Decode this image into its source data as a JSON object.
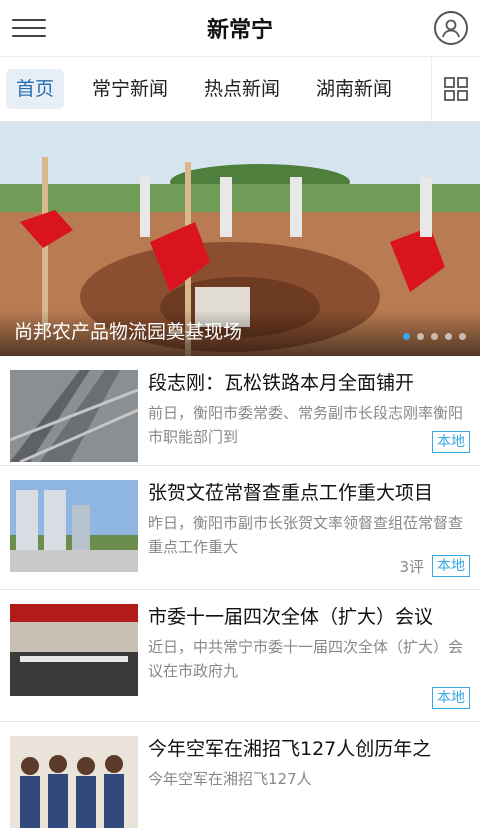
{
  "header": {
    "title": "新常宁"
  },
  "tabs": [
    {
      "label": "首页"
    },
    {
      "label": "常宁新闻"
    },
    {
      "label": "热点新闻"
    },
    {
      "label": "湖南新闻"
    }
  ],
  "banner": {
    "caption": "尚邦农产品物流园奠基现场",
    "slides": 5,
    "active_slide": 1
  },
  "news": [
    {
      "headline": "段志刚：瓦松铁路本月全面铺开",
      "summary": "前日，衡阳市委常委、常务副市长段志刚率衡阳市职能部门到",
      "comments": "",
      "tag": "本地"
    },
    {
      "headline": "张贺文莅常督查重点工作重大项目",
      "summary": "昨日，衡阳市副市长张贺文率领督查组莅常督查重点工作重大",
      "comments": "3评",
      "tag": "本地"
    },
    {
      "headline": "市委十一届四次全体（扩大）会议",
      "summary": "近日，中共常宁市委十一届四次全体（扩大）会议在市政府九",
      "comments": "",
      "tag": "本地"
    },
    {
      "headline": "今年空军在湘招飞127人创历年之",
      "summary": "今年空军在湘招飞127人",
      "comments": "",
      "tag": ""
    }
  ],
  "colors": {
    "accent": "#2a6fb5",
    "tag": "#3aa7e6"
  }
}
